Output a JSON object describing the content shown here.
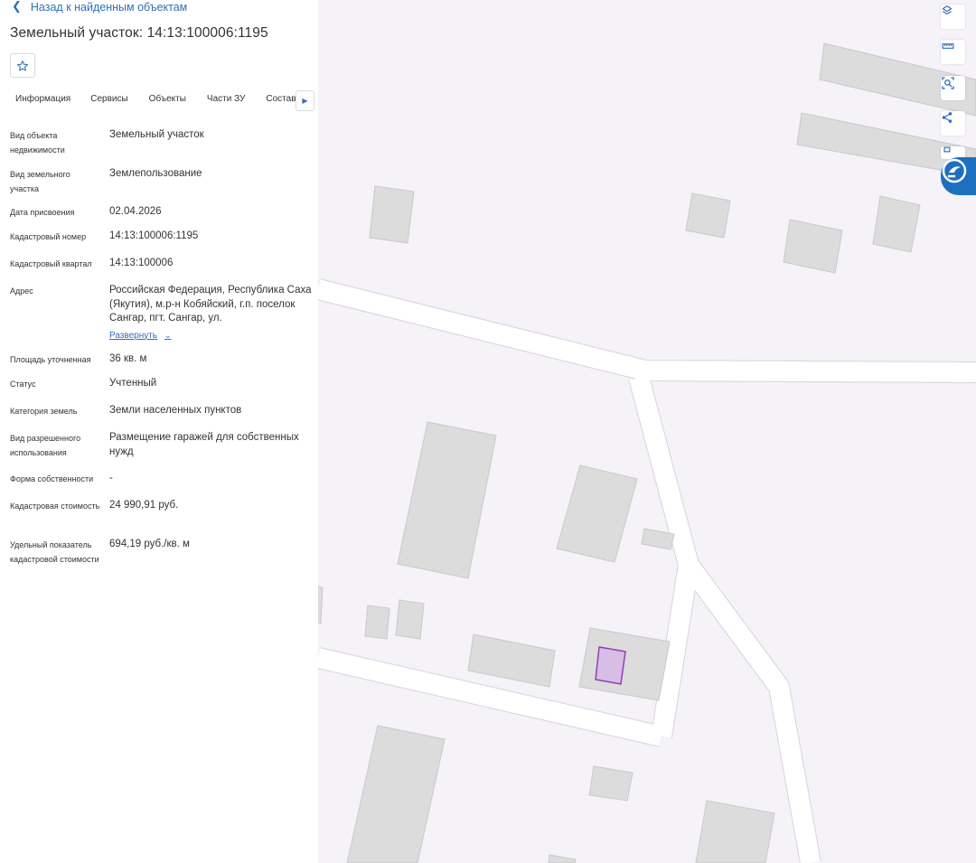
{
  "nav": {
    "back_label": "Назад к найденным объектам"
  },
  "header": {
    "title": "Земельный участок: 14:13:100006:1195"
  },
  "tabs": [
    "Информация",
    "Сервисы",
    "Объекты",
    "Части ЗУ",
    "Состав"
  ],
  "properties": [
    {
      "label": "Вид объекта недвижимости",
      "value": "Земельный участок"
    },
    {
      "label": "Вид земельного участка",
      "value": "Землепользование"
    },
    {
      "label": "Дата присвоения",
      "value": "02.04.2026"
    },
    {
      "label": "Кадастровый номер",
      "value": "14:13:100006:1195"
    },
    {
      "label": "Кадастровый квартал",
      "value": "14:13:100006"
    },
    {
      "label": "Адрес",
      "value": "Российская Федерация, Республика Саха (Якутия), м.р-н Кобяйский, г.п. поселок Сангар, пгт. Сангар, ул."
    },
    {
      "label": "Площадь уточненная",
      "value": "36 кв. м"
    },
    {
      "label": "Статус",
      "value": "Учтенный"
    },
    {
      "label": "Категория земель",
      "value": "Земли населенных пунктов"
    },
    {
      "label": "Вид разрешенного использования",
      "value": "Размещение гаражей для собственных нужд"
    },
    {
      "label": "Форма собственности",
      "value": "-"
    },
    {
      "label": "Кадастровая стоимость",
      "value": "24 990,91 руб."
    },
    {
      "label": "Удельный показатель кадастровой стоимости",
      "value": "694,19 руб./кв. м"
    }
  ],
  "address_expand_label": "Развернуть",
  "colors": {
    "accent": "#2f6fba",
    "map_bg": "#f5f2f8",
    "building": "#dcdcdc",
    "parcel": "#d8bde6"
  }
}
